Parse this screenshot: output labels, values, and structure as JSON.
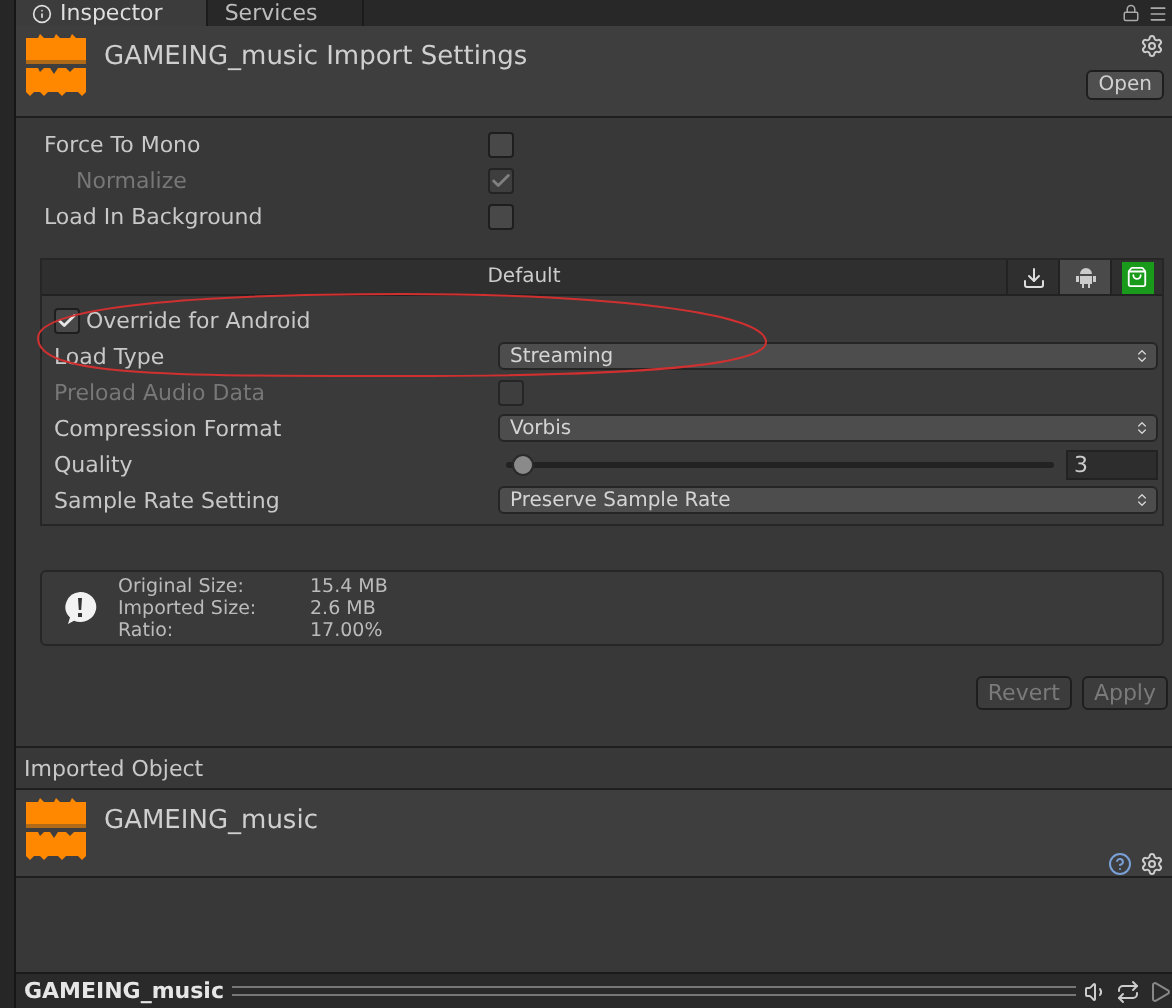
{
  "tabs": [
    {
      "label": "Inspector",
      "selected": true
    },
    {
      "label": "Services",
      "selected": false
    }
  ],
  "header": {
    "title": "GAMEING_music Import Settings",
    "open_button": "Open"
  },
  "options": [
    {
      "label": "Force To Mono",
      "checked": false,
      "disabled": false,
      "children": [
        {
          "label": "Normalize",
          "checked": true,
          "disabled": true
        }
      ]
    },
    {
      "label": "Load In Background",
      "checked": false,
      "disabled": false
    }
  ],
  "platform_bar": {
    "default_label": "Default",
    "platforms": [
      {
        "kind": "download",
        "selected": false
      },
      {
        "kind": "robot",
        "selected": true
      },
      {
        "kind": "store",
        "selected": false
      }
    ]
  },
  "override": {
    "label": "Override for Android",
    "checked": true
  },
  "settings": [
    {
      "kind": "dropdown",
      "label": "Load Type",
      "value": "Streaming"
    },
    {
      "kind": "checkbox",
      "label": "Preload Audio Data",
      "checked": false,
      "disabled": true
    },
    {
      "kind": "dropdown",
      "label": "Compression Format",
      "value": "Vorbis"
    },
    {
      "kind": "slider",
      "label": "Quality",
      "level": 0.03,
      "value": "3"
    },
    {
      "kind": "dropdown",
      "label": "Sample Rate Setting",
      "value": "Preserve Sample Rate"
    }
  ],
  "info": [
    {
      "label": "Original Size:",
      "value": "15.4 MB"
    },
    {
      "label": "Imported Size:",
      "value": "2.6 MB"
    },
    {
      "label": "Ratio:",
      "value": "17.00%"
    }
  ],
  "buttons": [
    {
      "label": "Revert",
      "disabled": true
    },
    {
      "label": "Apply",
      "disabled": true
    }
  ],
  "imported_object": {
    "heading": "Imported Object",
    "name": "GAMEING_music"
  },
  "preview": {
    "title": "GAMEING_music"
  }
}
